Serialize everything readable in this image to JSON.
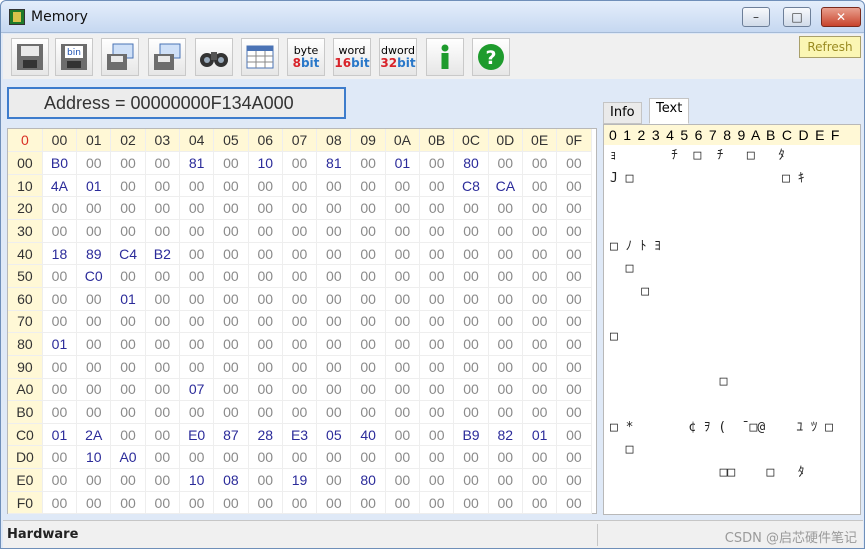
{
  "window": {
    "title": "Memory",
    "min": "–",
    "max": "□",
    "close": "✕"
  },
  "toolbar": {
    "byte_txt": "byte",
    "byte_bits": "8",
    "byte_unit": "bit",
    "word_txt": "word",
    "word_bits": "16",
    "word_unit": "bit",
    "dword_txt": "dword",
    "dword_bits": "32",
    "dword_unit": "bit",
    "refresh": "Refresh",
    "icons": [
      "save-icon",
      "save-bin-icon",
      "load-icon",
      "load-file-icon",
      "find-icon",
      "grid-icon",
      "info-icon",
      "help-icon"
    ]
  },
  "address": {
    "label": "Address = 00000000F134A000"
  },
  "hex": {
    "corner": "0",
    "cols": [
      "00",
      "01",
      "02",
      "03",
      "04",
      "05",
      "06",
      "07",
      "08",
      "09",
      "0A",
      "0B",
      "0C",
      "0D",
      "0E",
      "0F"
    ],
    "rows": [
      {
        "addr": "00",
        "cells": [
          "B0",
          "00",
          "00",
          "00",
          "81",
          "00",
          "10",
          "00",
          "81",
          "00",
          "01",
          "00",
          "80",
          "00",
          "00",
          "00"
        ]
      },
      {
        "addr": "10",
        "cells": [
          "4A",
          "01",
          "00",
          "00",
          "00",
          "00",
          "00",
          "00",
          "00",
          "00",
          "00",
          "00",
          "C8",
          "CA",
          "00",
          "00"
        ]
      },
      {
        "addr": "20",
        "cells": [
          "00",
          "00",
          "00",
          "00",
          "00",
          "00",
          "00",
          "00",
          "00",
          "00",
          "00",
          "00",
          "00",
          "00",
          "00",
          "00"
        ]
      },
      {
        "addr": "30",
        "cells": [
          "00",
          "00",
          "00",
          "00",
          "00",
          "00",
          "00",
          "00",
          "00",
          "00",
          "00",
          "00",
          "00",
          "00",
          "00",
          "00"
        ]
      },
      {
        "addr": "40",
        "cells": [
          "18",
          "89",
          "C4",
          "B2",
          "00",
          "00",
          "00",
          "00",
          "00",
          "00",
          "00",
          "00",
          "00",
          "00",
          "00",
          "00"
        ]
      },
      {
        "addr": "50",
        "cells": [
          "00",
          "C0",
          "00",
          "00",
          "00",
          "00",
          "00",
          "00",
          "00",
          "00",
          "00",
          "00",
          "00",
          "00",
          "00",
          "00"
        ]
      },
      {
        "addr": "60",
        "cells": [
          "00",
          "00",
          "01",
          "00",
          "00",
          "00",
          "00",
          "00",
          "00",
          "00",
          "00",
          "00",
          "00",
          "00",
          "00",
          "00"
        ]
      },
      {
        "addr": "70",
        "cells": [
          "00",
          "00",
          "00",
          "00",
          "00",
          "00",
          "00",
          "00",
          "00",
          "00",
          "00",
          "00",
          "00",
          "00",
          "00",
          "00"
        ]
      },
      {
        "addr": "80",
        "cells": [
          "01",
          "00",
          "00",
          "00",
          "00",
          "00",
          "00",
          "00",
          "00",
          "00",
          "00",
          "00",
          "00",
          "00",
          "00",
          "00"
        ]
      },
      {
        "addr": "90",
        "cells": [
          "00",
          "00",
          "00",
          "00",
          "00",
          "00",
          "00",
          "00",
          "00",
          "00",
          "00",
          "00",
          "00",
          "00",
          "00",
          "00"
        ]
      },
      {
        "addr": "A0",
        "cells": [
          "00",
          "00",
          "00",
          "00",
          "07",
          "00",
          "00",
          "00",
          "00",
          "00",
          "00",
          "00",
          "00",
          "00",
          "00",
          "00"
        ]
      },
      {
        "addr": "B0",
        "cells": [
          "00",
          "00",
          "00",
          "00",
          "00",
          "00",
          "00",
          "00",
          "00",
          "00",
          "00",
          "00",
          "00",
          "00",
          "00",
          "00"
        ]
      },
      {
        "addr": "C0",
        "cells": [
          "01",
          "2A",
          "00",
          "00",
          "E0",
          "87",
          "28",
          "E3",
          "05",
          "40",
          "00",
          "00",
          "B9",
          "82",
          "01",
          "00"
        ]
      },
      {
        "addr": "D0",
        "cells": [
          "00",
          "10",
          "A0",
          "00",
          "00",
          "00",
          "00",
          "00",
          "00",
          "00",
          "00",
          "00",
          "00",
          "00",
          "00",
          "00"
        ]
      },
      {
        "addr": "E0",
        "cells": [
          "00",
          "00",
          "00",
          "00",
          "10",
          "08",
          "00",
          "19",
          "00",
          "80",
          "00",
          "00",
          "00",
          "00",
          "00",
          "00"
        ]
      },
      {
        "addr": "F0",
        "cells": [
          "00",
          "00",
          "00",
          "00",
          "00",
          "00",
          "00",
          "00",
          "00",
          "00",
          "00",
          "00",
          "00",
          "00",
          "00",
          "00"
        ]
      }
    ]
  },
  "right": {
    "tabs": [
      "Info",
      "Text"
    ],
    "text_header": "0 1 2 3 4 5 6 7 8 9 A B C D E F",
    "text_rows": [
      "ｮ       ﾁ  □  ﾁ   □   ﾀ",
      "J □                   □ ｷ",
      "",
      "",
      "□ ﾉ ﾄ ﾖ",
      "  □",
      "    □",
      "",
      "□",
      "",
      "              □",
      "",
      "□ *       ¢ ｦ (  ̄ □@    ﾕ ﾂ □",
      "  □",
      "              □□    □   ﾀ",
      ""
    ]
  },
  "status": {
    "left": "Hardware",
    "watermark": "CSDN @启芯硬件笔记"
  }
}
